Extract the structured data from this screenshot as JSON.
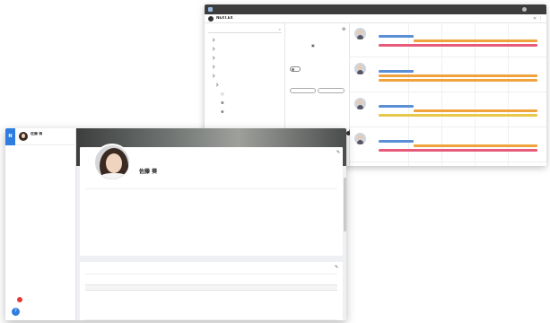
{
  "back_window": {
    "title": "NEXT.EX",
    "header_right": "",
    "search_placeholder": "",
    "tree_items": [
      "",
      "",
      "",
      "",
      "",
      "",
      "",
      "",
      "",
      ""
    ],
    "form_labels": [
      "",
      "",
      "",
      "",
      "",
      ""
    ],
    "form_values": [
      "",
      "",
      ""
    ],
    "pill_labels": [
      "",
      ""
    ],
    "toolbar_labels": [
      "",
      "",
      "",
      ""
    ],
    "people": [
      {
        "name": "",
        "bars": [
          {
            "color": "#5a8fd6",
            "label": ""
          },
          {
            "color": "#f0a33c",
            "label": ""
          },
          {
            "color": "#e85a7a",
            "label": ""
          }
        ]
      },
      {
        "name": "",
        "bars": [
          {
            "color": "#5a8fd6",
            "label": ""
          },
          {
            "color": "#f0a33c",
            "label": ""
          },
          {
            "color": "#f0a33c",
            "label": ""
          }
        ]
      },
      {
        "name": "",
        "bars": [
          {
            "color": "#5a8fd6",
            "label": ""
          },
          {
            "color": "#f0a33c",
            "label": ""
          },
          {
            "color": "#e8c84a",
            "label": ""
          }
        ]
      },
      {
        "name": "",
        "bars": [
          {
            "color": "#5a8fd6",
            "label": ""
          },
          {
            "color": "#f0a33c",
            "label": ""
          },
          {
            "color": "#e85a7a",
            "label": ""
          }
        ]
      }
    ],
    "footer": ""
  },
  "front_window": {
    "user": {
      "name": "佐藤 葵",
      "sub": ""
    },
    "nav_items": [
      "",
      "",
      "",
      "",
      "",
      "",
      "",
      "",
      "",
      "",
      "",
      "",
      "",
      "",
      "",
      "",
      "",
      "",
      "",
      "",
      "",
      "",
      ""
    ],
    "banner_badge": "",
    "profile_name": "佐藤 葵",
    "fields_left": [
      {
        "k": "",
        "v": ""
      },
      {
        "k": "",
        "v": ""
      },
      {
        "k": "",
        "v": ""
      },
      {
        "k": "",
        "v": ""
      },
      {
        "k": "",
        "v": ""
      },
      {
        "k": "",
        "v": ""
      },
      {
        "k": "",
        "v": ""
      }
    ],
    "fields_right": [
      {
        "k": "",
        "v": ""
      },
      {
        "k": "",
        "v": ""
      },
      {
        "k": "",
        "v": ""
      },
      {
        "k": "",
        "v": ""
      },
      {
        "k": "",
        "v": ""
      },
      {
        "k": "",
        "v": ""
      }
    ],
    "section2": {
      "title": "",
      "subtitle": "",
      "columns": [
        "",
        "",
        "",
        ""
      ],
      "row_date": "",
      "cells": [
        "",
        "",
        "",
        "",
        "",
        ""
      ]
    }
  },
  "colors": {
    "accent": "#3a6ed4",
    "dark_bar": "#3d3d3d",
    "bar_blue": "#5a8fd6",
    "bar_orange": "#f0a33c",
    "bar_pink": "#e85a7a",
    "bar_yellow": "#e8c84a",
    "logo_blue": "#2f7de1"
  }
}
